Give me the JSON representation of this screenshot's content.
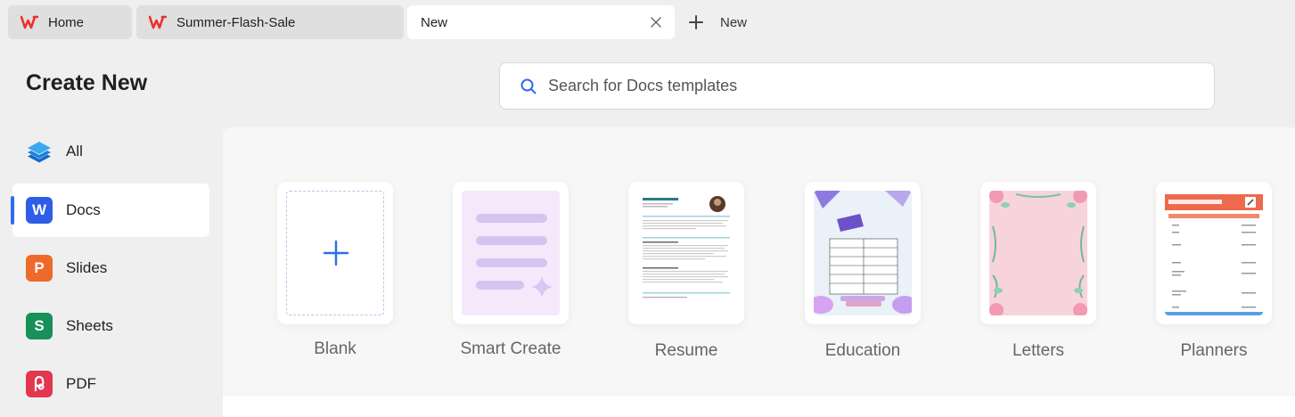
{
  "tabs": [
    {
      "label": "Home",
      "icon": "wps-logo-icon"
    },
    {
      "label": "Summer-Flash-Sale",
      "icon": "wps-logo-icon"
    },
    {
      "label": "New",
      "active": true
    }
  ],
  "new_tab_label": "New",
  "page_title": "Create New",
  "search": {
    "placeholder": "Search for Docs templates"
  },
  "sidebar": {
    "items": [
      {
        "label": "All",
        "icon": "layers-icon"
      },
      {
        "label": "Docs",
        "icon": "docs-w-icon",
        "active": true
      },
      {
        "label": "Slides",
        "icon": "slides-p-icon"
      },
      {
        "label": "Sheets",
        "icon": "sheets-s-icon"
      },
      {
        "label": "PDF",
        "icon": "pdf-icon"
      }
    ]
  },
  "templates": [
    {
      "label": "Blank"
    },
    {
      "label": "Smart Create"
    },
    {
      "label": "Resume"
    },
    {
      "label": "Education"
    },
    {
      "label": "Letters"
    },
    {
      "label": "Planners"
    }
  ],
  "colors": {
    "accent": "#2e6bf2",
    "wps_red": "#e8322d",
    "docs_blue": "#2f5de8",
    "slides_orange": "#ee6a2a",
    "sheets_green": "#17905a",
    "pdf_red": "#e2374f"
  }
}
